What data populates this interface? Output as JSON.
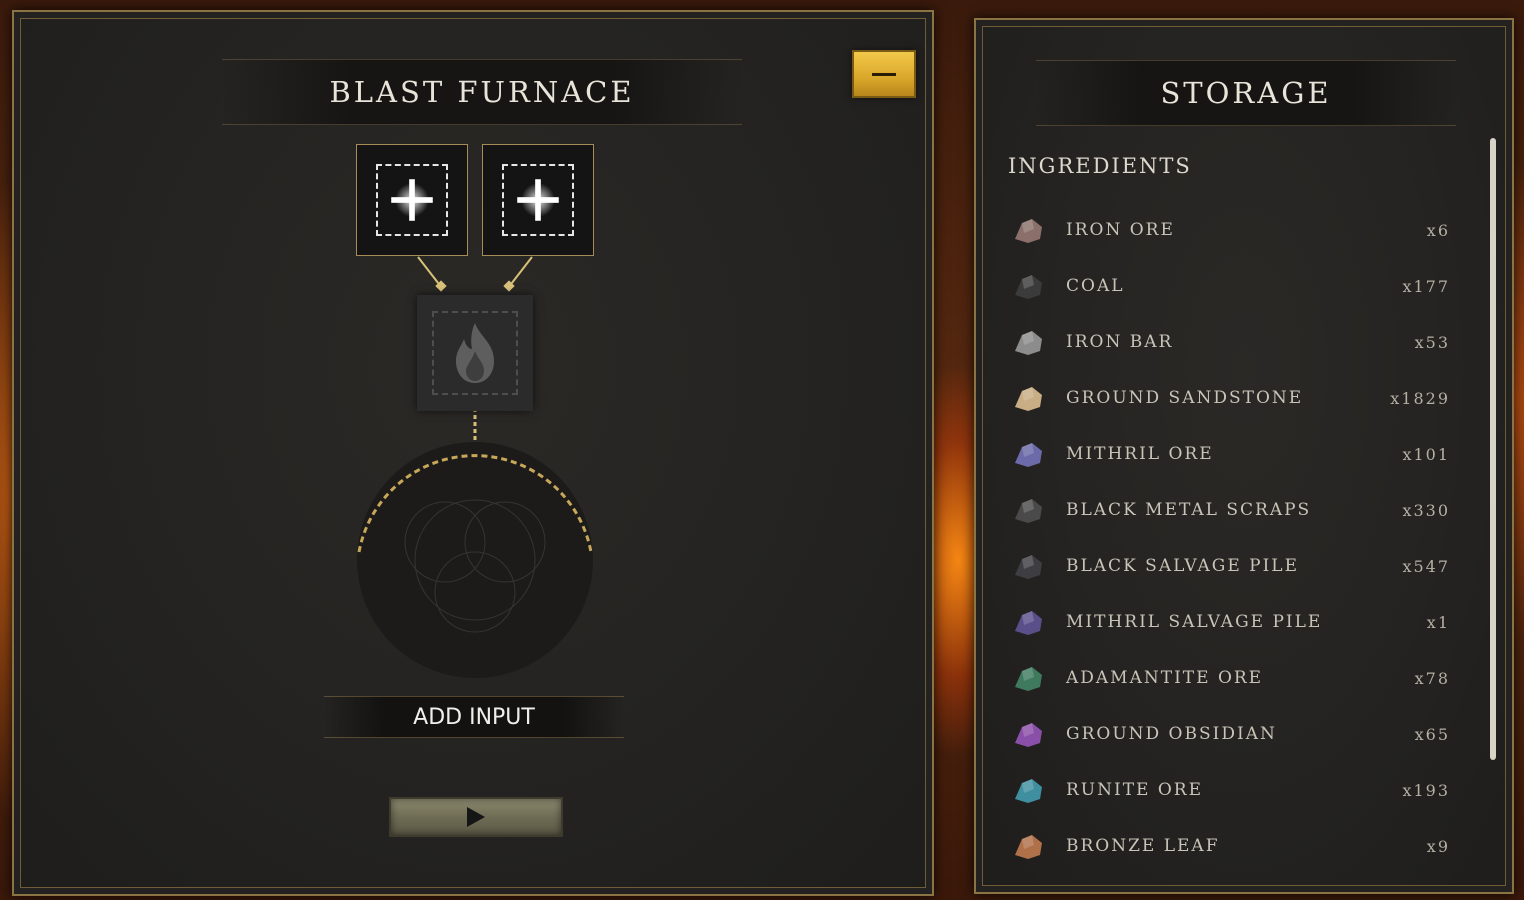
{
  "furnace": {
    "title": "BLAST FURNACE",
    "add_input_label": "ADD INPUT"
  },
  "storage": {
    "title": "STORAGE",
    "section": "INGREDIENTS",
    "items": [
      {
        "name": "IRON ORE",
        "count": "x6",
        "icon": "iron-ore-icon",
        "color": "#8a6f6a"
      },
      {
        "name": "COAL",
        "count": "x177",
        "icon": "coal-icon",
        "color": "#3b3b3b"
      },
      {
        "name": "IRON BAR",
        "count": "x53",
        "icon": "iron-bar-icon",
        "color": "#8c8c8c"
      },
      {
        "name": "GROUND SANDSTONE",
        "count": "x1829",
        "icon": "ground-sandstone-icon",
        "color": "#c9ad84"
      },
      {
        "name": "MITHRIL ORE",
        "count": "x101",
        "icon": "mithril-ore-icon",
        "color": "#6c6aa8"
      },
      {
        "name": "BLACK METAL SCRAPS",
        "count": "x330",
        "icon": "black-metal-scraps-icon",
        "color": "#4a4a4a"
      },
      {
        "name": "BLACK SALVAGE PILE",
        "count": "x547",
        "icon": "black-salvage-pile-icon",
        "color": "#3e3e42"
      },
      {
        "name": "MITHRIL SALVAGE PILE",
        "count": "x1",
        "icon": "mithril-salvage-pile-icon",
        "color": "#5b4f8a"
      },
      {
        "name": "ADAMANTITE ORE",
        "count": "x78",
        "icon": "adamantite-ore-icon",
        "color": "#3f7a5e"
      },
      {
        "name": "GROUND OBSIDIAN",
        "count": "x65",
        "icon": "ground-obsidian-icon",
        "color": "#8a4fa8"
      },
      {
        "name": "RUNITE ORE",
        "count": "x193",
        "icon": "runite-ore-icon",
        "color": "#3f8fa0"
      },
      {
        "name": "BRONZE LEAF",
        "count": "x9",
        "icon": "bronze-leaf-icon",
        "color": "#b0704a"
      }
    ]
  },
  "colors": {
    "accent_gold": "#d9a72a",
    "border_gold": "#8a7444",
    "panel_bg": "#242321"
  }
}
